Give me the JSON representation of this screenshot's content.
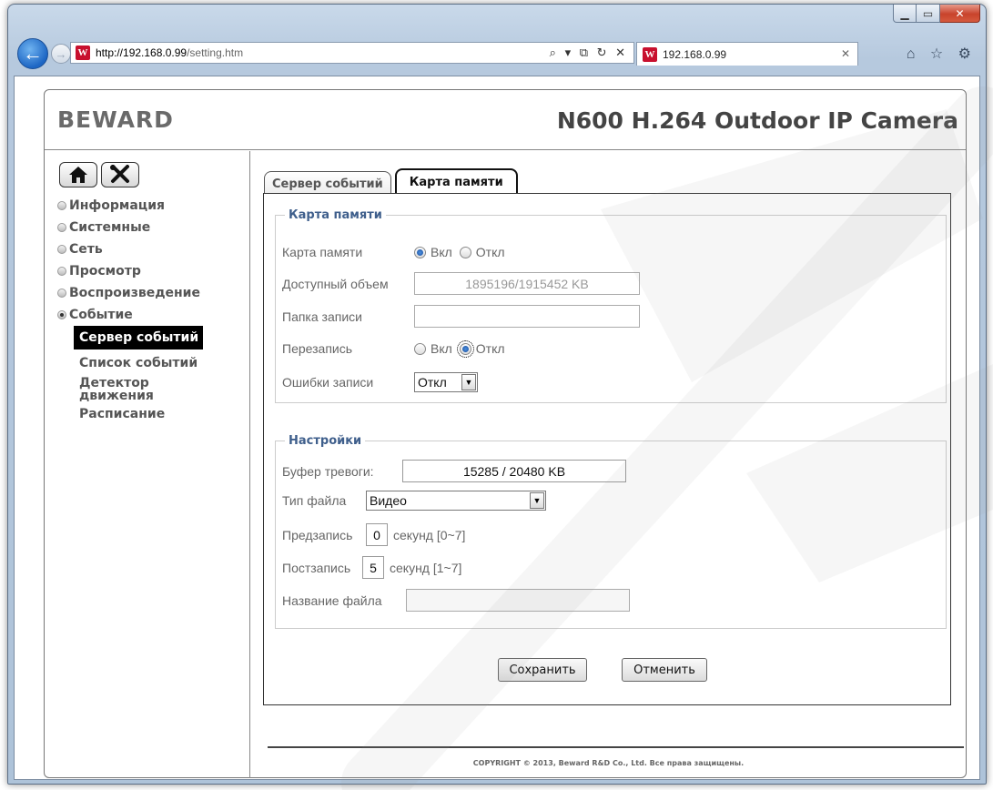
{
  "browser": {
    "url_host": "http://192.168.0.99",
    "url_path": "/setting.htm",
    "addr_tools": "⌕ ▾ ⧉ ↻ ✕",
    "tab_title": "192.168.0.99",
    "tab_close": "✕",
    "window_min": "▁",
    "window_max": "▭",
    "window_close": "✕",
    "toolbar_icons": "⌂ ☆ ⚙",
    "site_icon_letter": "W"
  },
  "page": {
    "logo": "BEWARD",
    "model_title": "N600 H.264 Outdoor IP Camera"
  },
  "sidebar": {
    "home_icon": "home-icon",
    "tools_icon": "tools-icon",
    "items": [
      {
        "label": "Информация"
      },
      {
        "label": "Системные"
      },
      {
        "label": "Сеть"
      },
      {
        "label": "Просмотр"
      },
      {
        "label": "Воспроизведение"
      },
      {
        "label": "Событие"
      }
    ],
    "subitems": [
      {
        "label": "Сервер событий"
      },
      {
        "label": "Список событий"
      },
      {
        "label": "Детектор движения"
      },
      {
        "label": "Расписание"
      }
    ]
  },
  "tabs": [
    {
      "label": "Сервер событий"
    },
    {
      "label": "Карта памяти"
    }
  ],
  "memory_card": {
    "legend": "Карта памяти",
    "card_label": "Карта памяти",
    "on_label": "Вкл",
    "off_label": "Откл",
    "available_label": "Доступный объем",
    "available_value": "1895196/1915452 KB",
    "folder_label": "Папка записи",
    "folder_value": "",
    "overwrite_label": "Перезапись",
    "overwrite_on": "Вкл",
    "overwrite_off": "Откл",
    "errors_label": "Ошибки записи",
    "errors_value": "Откл"
  },
  "settings": {
    "legend": "Настройки",
    "buffer_label": "Буфер тревоги:",
    "buffer_value": "15285 / 20480 KB",
    "filetype_label": "Тип файла",
    "filetype_value": "Видео",
    "prerecord_label": "Предзапись",
    "prerecord_value": "0",
    "prerecord_unit": "секунд [0~7]",
    "postrecord_label": "Постзапись",
    "postrecord_value": "5",
    "postrecord_unit": "секунд [1~7]",
    "filename_label": "Название файла",
    "filename_value": ""
  },
  "buttons": {
    "save": "Сохранить",
    "cancel": "Отменить"
  },
  "footer": {
    "copyright": "COPYRIGHT © 2013, Beward R&D Co., Ltd. Все права защищены."
  },
  "colors": {
    "legend": "#3f5f8c",
    "active_nav": "#000000",
    "close_button": "#c8432c",
    "back_button": "#1d66c4"
  }
}
